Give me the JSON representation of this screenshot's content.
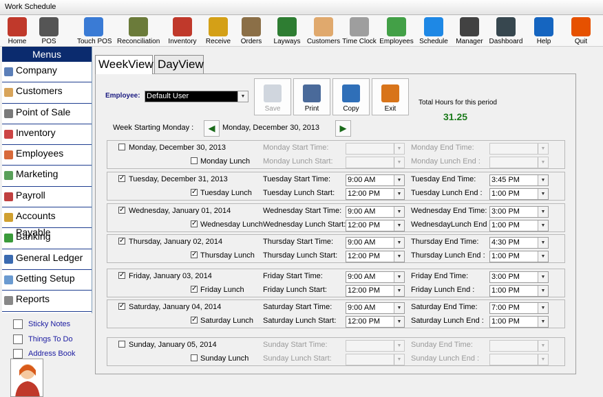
{
  "window": {
    "title": "Work Schedule"
  },
  "toolbar": [
    {
      "label": "Home",
      "icon": "house-icon",
      "color": "#c0392b"
    },
    {
      "label": "POS",
      "icon": "cash-register-icon",
      "color": "#555555"
    },
    {
      "label": "Touch POS",
      "icon": "touchscreen-icon",
      "color": "#3a7bd5"
    },
    {
      "label": "Reconciliation",
      "icon": "money-stack-icon",
      "color": "#6b7b3a"
    },
    {
      "label": "Inventory",
      "icon": "book-icon",
      "color": "#c0392b"
    },
    {
      "label": "Receive",
      "icon": "forklift-icon",
      "color": "#d4a017"
    },
    {
      "label": "Orders",
      "icon": "clipboard-icon",
      "color": "#8b6f47"
    },
    {
      "label": "Layways",
      "icon": "money-calendar-icon",
      "color": "#2e7d32"
    },
    {
      "label": "Customers",
      "icon": "handshake-icon",
      "color": "#e0a96d"
    },
    {
      "label": "Time Clock",
      "icon": "clock-icon",
      "color": "#9e9e9e"
    },
    {
      "label": "Employees",
      "icon": "people-icon",
      "color": "#43a047"
    },
    {
      "label": "Schedule",
      "icon": "schedule-icon",
      "color": "#1e88e5"
    },
    {
      "label": "Manager",
      "icon": "manager-icon",
      "color": "#424242"
    },
    {
      "label": "Dashboard",
      "icon": "gauge-icon",
      "color": "#37474f"
    },
    {
      "label": "Help",
      "icon": "help-icon",
      "color": "#1565c0"
    },
    {
      "label": "Quit",
      "icon": "door-icon",
      "color": "#e65100"
    }
  ],
  "sidebar": {
    "header": "Menus",
    "items": [
      {
        "label": "Company",
        "icon": "company-icon",
        "color": "#5b7fb8"
      },
      {
        "label": "Customers",
        "icon": "customers-icon",
        "color": "#d8a45a"
      },
      {
        "label": "Point of Sale",
        "icon": "pos-icon",
        "color": "#7a7a7a"
      },
      {
        "label": "Inventory",
        "icon": "inventory-icon",
        "color": "#c44"
      },
      {
        "label": "Employees",
        "icon": "employees-icon",
        "color": "#d86a3a"
      },
      {
        "label": "Marketing",
        "icon": "marketing-icon",
        "color": "#5aa05a"
      },
      {
        "label": "Payroll",
        "icon": "payroll-icon",
        "color": "#c04040"
      },
      {
        "label": "Accounts Payable",
        "icon": "accounts-payable-icon",
        "color": "#d0a030"
      },
      {
        "label": "Banking",
        "icon": "banking-icon",
        "color": "#3a9a3a"
      },
      {
        "label": "General Ledger",
        "icon": "ledger-icon",
        "color": "#3a6ab0"
      },
      {
        "label": "Getting Setup",
        "icon": "setup-icon",
        "color": "#6a9ad0"
      },
      {
        "label": "Reports",
        "icon": "reports-icon",
        "color": "#888888"
      }
    ],
    "extras": [
      {
        "label": "Sticky Notes",
        "icon": "sticky-note-icon"
      },
      {
        "label": "Things To Do",
        "icon": "hammer-icon"
      },
      {
        "label": "Address Book",
        "icon": "address-book-icon"
      }
    ]
  },
  "tabs": [
    {
      "label": "WeekView",
      "active": true
    },
    {
      "label": "DayView",
      "active": false
    }
  ],
  "header": {
    "employee_label": "Employee:",
    "employee_value": "Default User",
    "buttons": [
      {
        "label": "Save",
        "icon": "save-icon",
        "enabled": false
      },
      {
        "label": "Print",
        "icon": "printer-icon",
        "enabled": true
      },
      {
        "label": "Copy",
        "icon": "copy-icon",
        "enabled": true
      },
      {
        "label": "Exit",
        "icon": "exit-icon",
        "enabled": true
      }
    ],
    "total_label": "Total Hours for this period",
    "total_value": "31.25",
    "week_label": "Week Starting Monday :",
    "week_value": "Monday, December 30, 2013"
  },
  "days": [
    {
      "date": "Monday, December 30, 2013",
      "checked": false,
      "lunch_label": "Monday Lunch",
      "lunch_checked": false,
      "start_label": "Monday Start Time:",
      "start": "",
      "end_label": "Monday End Time:",
      "end": "",
      "lstart_label": "Monday Lunch Start:",
      "lstart": "",
      "lend_label": "Monday Lunch End :",
      "lend": ""
    },
    {
      "date": "Tuesday, December 31, 2013",
      "checked": true,
      "lunch_label": "Tuesday Lunch",
      "lunch_checked": true,
      "start_label": "Tuesday Start Time:",
      "start": "9:00 AM",
      "end_label": "Tuesday End Time:",
      "end": "3:45 PM",
      "lstart_label": "Tuesday Lunch Start:",
      "lstart": "12:00 PM",
      "lend_label": "Tuesday Lunch End :",
      "lend": "1:00 PM"
    },
    {
      "date": "Wednesday, January 01, 2014",
      "checked": true,
      "lunch_label": "Wednesday Lunch",
      "lunch_checked": true,
      "start_label": "Wednesday Start Time:",
      "start": "9:00 AM",
      "end_label": "Wednesday End Time:",
      "end": "3:00 PM",
      "lstart_label": "Wednesday Lunch Start:",
      "lstart": "12:00 PM",
      "lend_label": "WednesdayLunch End :",
      "lend": "1:00 PM"
    },
    {
      "date": "Thursday, January 02, 2014",
      "checked": true,
      "lunch_label": "Thursday Lunch",
      "lunch_checked": true,
      "start_label": "Thursday Start Time:",
      "start": "9:00 AM",
      "end_label": "Thursday End Time:",
      "end": "4:30 PM",
      "lstart_label": "Thursday Lunch Start:",
      "lstart": "12:00 PM",
      "lend_label": "Thursday Lunch End :",
      "lend": "1:00 PM"
    },
    {
      "date": "Friday, January 03, 2014",
      "checked": true,
      "lunch_label": "Friday Lunch",
      "lunch_checked": true,
      "start_label": "Friday Start Time:",
      "start": "9:00 AM",
      "end_label": "Friday End Time:",
      "end": "3:00 PM",
      "lstart_label": "Friday Lunch Start:",
      "lstart": "12:00 PM",
      "lend_label": "Friday Lunch End :",
      "lend": "1:00 PM"
    },
    {
      "date": "Saturday, January 04, 2014",
      "checked": true,
      "lunch_label": "Saturday Lunch",
      "lunch_checked": true,
      "start_label": "Saturday Start Time:",
      "start": "9:00 AM",
      "end_label": "Saturday End Time:",
      "end": "7:00 PM",
      "lstart_label": "Saturday Lunch Start:",
      "lstart": "12:00 PM",
      "lend_label": "Saturday Lunch End :",
      "lend": "1:00 PM"
    },
    {
      "date": "Sunday, January 05, 2014",
      "checked": false,
      "lunch_label": "Sunday Lunch",
      "lunch_checked": false,
      "start_label": "Sunday Start Time:",
      "start": "",
      "end_label": "Sunday End Time:",
      "end": "",
      "lstart_label": "Sunday Lunch Start:",
      "lstart": "",
      "lend_label": "Sunday Lunch End :",
      "lend": ""
    }
  ],
  "colors": {
    "accent": "#0b2b6e",
    "total": "#1a7a1a",
    "link": "#1a1aa0"
  }
}
